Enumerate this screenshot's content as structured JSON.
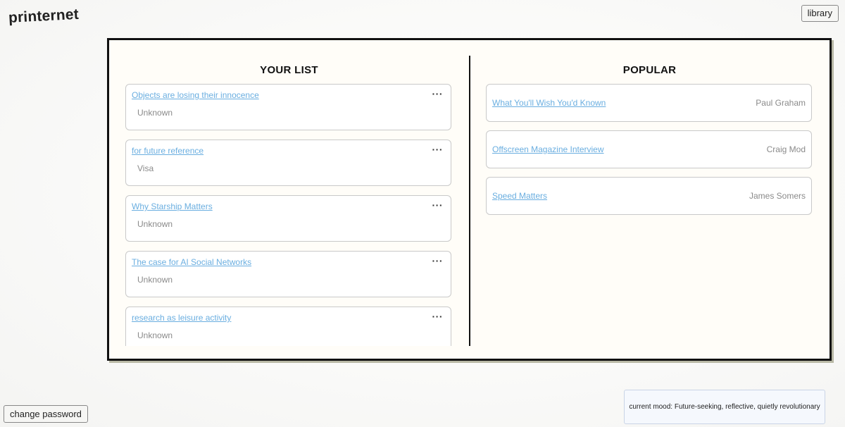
{
  "app": {
    "logo": "printernet"
  },
  "header": {
    "library_label": "library"
  },
  "your_list": {
    "title": "YOUR LIST",
    "items": [
      {
        "title": "Objects are losing their innocence",
        "source": "Unknown"
      },
      {
        "title": "for future reference",
        "source": "Visa"
      },
      {
        "title": "Why Starship Matters",
        "source": "Unknown"
      },
      {
        "title": "The case for AI Social Networks",
        "source": "Unknown"
      },
      {
        "title": "research as leisure activity",
        "source": "Unknown"
      }
    ],
    "menu_glyph": "···"
  },
  "popular": {
    "title": "POPULAR",
    "items": [
      {
        "title": "What You'll Wish You'd Known",
        "author": "Paul Graham"
      },
      {
        "title": "Offscreen Magazine Interview",
        "author": "Craig Mod"
      },
      {
        "title": "Speed Matters",
        "author": "James Somers"
      }
    ]
  },
  "footer": {
    "change_password_label": "change password",
    "mood_text": "current mood: Future-seeking, reflective, quietly revolutionary"
  },
  "colors": {
    "link": "#6aaee0",
    "muted": "#8a8a8a",
    "panel_bg": "#fffdf8",
    "panel_border": "#111111"
  }
}
